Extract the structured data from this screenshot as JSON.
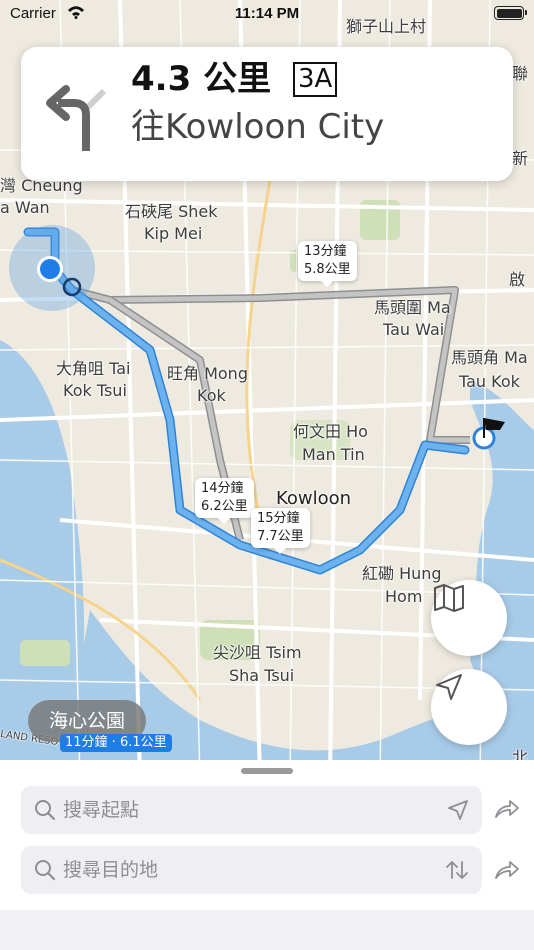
{
  "status_bar": {
    "carrier": "Carrier",
    "time": "11:14 PM"
  },
  "banner": {
    "distance": "4.3 公里",
    "shield": "3A",
    "toward": "往Kowloon City"
  },
  "map": {
    "places": [
      {
        "id": "lion-rock",
        "text": "獅子山上村"
      },
      {
        "id": "cheung-sha-wan",
        "text": "灣 Cheung"
      },
      {
        "id": "cheung-sha-wan-2",
        "text": "a Wan"
      },
      {
        "id": "shek-kip-mei",
        "text": "石硤尾 Shek"
      },
      {
        "id": "shek-kip-mei-2",
        "text": "Kip Mei"
      },
      {
        "id": "ma-tau-wai",
        "text": "馬頭圍 Ma"
      },
      {
        "id": "ma-tau-wai-2",
        "text": "Tau Wai"
      },
      {
        "id": "tai-kok-tsui",
        "text": "大角咀 Tai"
      },
      {
        "id": "tai-kok-tsui-2",
        "text": "Kok Tsui"
      },
      {
        "id": "mong-kok",
        "text": "旺角 Mong"
      },
      {
        "id": "mong-kok-2",
        "text": "Kok"
      },
      {
        "id": "ma-tau-kok",
        "text": "馬頭角 Ma"
      },
      {
        "id": "ma-tau-kok-2",
        "text": "Tau Kok"
      },
      {
        "id": "ho-man-tin",
        "text": "何文田 Ho"
      },
      {
        "id": "ho-man-tin-2",
        "text": "Man Tin"
      },
      {
        "id": "kowloon",
        "text": "Kowloon"
      },
      {
        "id": "hung-hom",
        "text": "紅磡 Hung"
      },
      {
        "id": "hung-hom-2",
        "text": "Hom"
      },
      {
        "id": "tsim-sha-tsui",
        "text": "尖沙咀 Tsim"
      },
      {
        "id": "tsim-sha-tsui-2",
        "text": "Sha Tsui"
      },
      {
        "id": "kai-1",
        "text": "啟"
      },
      {
        "id": "san-po-kong",
        "text": "新"
      },
      {
        "id": "lin",
        "text": "聯"
      },
      {
        "id": "north",
        "text": "北"
      },
      {
        "id": "island",
        "text": "LAND RESO"
      }
    ],
    "route_callouts": [
      {
        "id": "alt-route-1",
        "time": "13分鐘",
        "distance": "5.8公里"
      },
      {
        "id": "alt-route-2",
        "time": "14分鐘",
        "distance": "6.2公里"
      },
      {
        "id": "main-route",
        "time": "15分鐘",
        "distance": "7.7公里"
      }
    ],
    "park_label": "海心公園",
    "park_route": "11分鐘 · 6.1公里"
  },
  "sheet": {
    "start_placeholder": "搜尋起點",
    "destination_placeholder": "搜尋目的地"
  },
  "colors": {
    "route_primary": "#5aa7ea",
    "route_alt": "#a9a9a9",
    "location_dot": "#1e7de6",
    "water": "#a8cbe8"
  }
}
